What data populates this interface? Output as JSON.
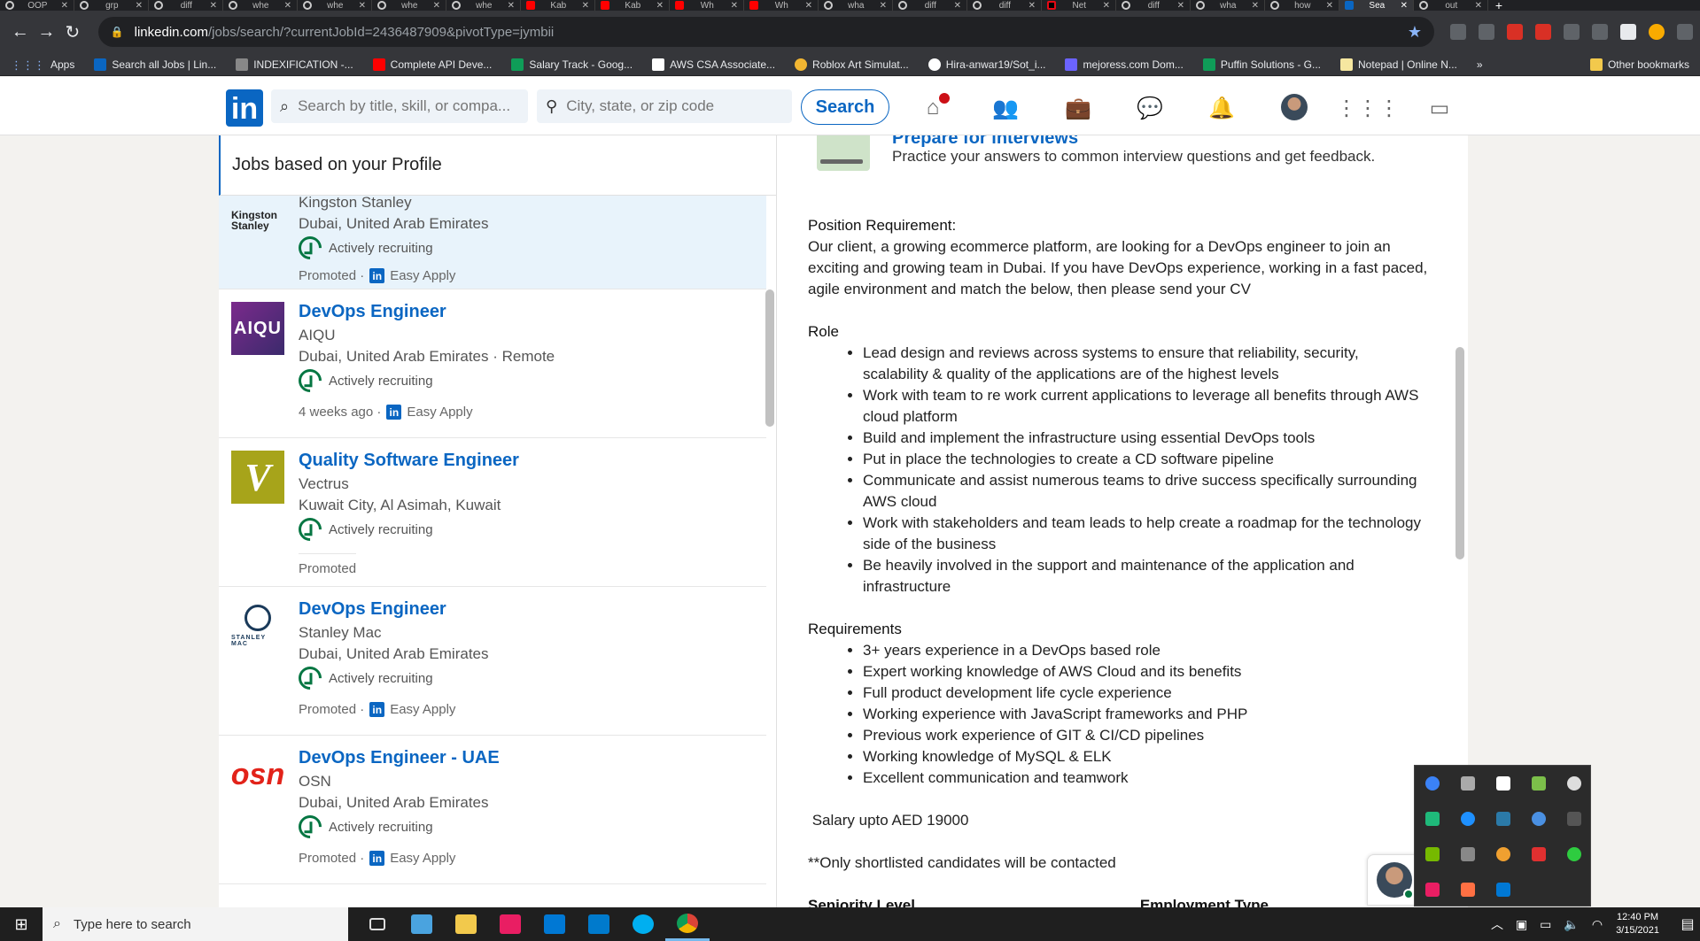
{
  "browser": {
    "tabs": [
      {
        "label": "OOP",
        "icon": "chrome-icon"
      },
      {
        "label": "grp",
        "icon": "chrome-icon"
      },
      {
        "label": "diff",
        "icon": "chrome-icon"
      },
      {
        "label": "whe",
        "icon": "chrome-icon"
      },
      {
        "label": "whe",
        "icon": "chrome-icon"
      },
      {
        "label": "whe",
        "icon": "chrome-icon"
      },
      {
        "label": "whe",
        "icon": "chrome-icon"
      },
      {
        "label": "Kab",
        "icon": "youtube-icon"
      },
      {
        "label": "Kab",
        "icon": "youtube-icon"
      },
      {
        "label": "Wh",
        "icon": "youtube-icon"
      },
      {
        "label": "Wh",
        "icon": "youtube-icon"
      },
      {
        "label": "wha",
        "icon": "chrome-icon"
      },
      {
        "label": "diff",
        "icon": "chrome-icon"
      },
      {
        "label": "diff",
        "icon": "chrome-icon"
      },
      {
        "label": "Net",
        "icon": "netflix-icon"
      },
      {
        "label": "diff",
        "icon": "chrome-icon"
      },
      {
        "label": "wha",
        "icon": "chrome-icon"
      },
      {
        "label": "how",
        "icon": "chrome-icon"
      },
      {
        "label": "Sea",
        "icon": "linkedin-icon",
        "active": true
      },
      {
        "label": "out",
        "icon": "chrome-icon"
      }
    ],
    "url_host": "linkedin.com",
    "url_path": "/jobs/search/?currentJobId=2436487909&pivotType=jymbii",
    "bookmarks": [
      {
        "label": "Apps",
        "icon": "apps-grid-icon"
      },
      {
        "label": "Search all Jobs | Lin...",
        "icon": "linkedin-icon"
      },
      {
        "label": "INDEXIFICATION -...",
        "icon": "blank-icon"
      },
      {
        "label": "Complete API Deve...",
        "icon": "youtube-icon"
      },
      {
        "label": "Salary Track - Goog...",
        "icon": "sheets-icon"
      },
      {
        "label": "AWS CSA Associate...",
        "icon": "aws-icon"
      },
      {
        "label": "Roblox Art Simulat...",
        "icon": "roblox-icon"
      },
      {
        "label": "Hira-anwar19/Sot_i...",
        "icon": "github-icon"
      },
      {
        "label": "mejoress.com Dom...",
        "icon": "mail-icon"
      },
      {
        "label": "Puffin Solutions - G...",
        "icon": "sheets-icon"
      },
      {
        "label": "Notepad | Online N...",
        "icon": "notepad-icon"
      }
    ],
    "bookmarks_more": "»",
    "other_bookmarks": "Other bookmarks"
  },
  "linkedin": {
    "logo": "in",
    "search_placeholder": "Search by title, skill, or compa...",
    "location_placeholder": "City, state, or zip code",
    "search_button": "Search",
    "brand_color": "#0a66c2"
  },
  "list": {
    "header": "Jobs based on your Profile",
    "jobs": [
      {
        "logo_text": "Kingston Stanley",
        "company": "Kingston Stanley",
        "location": "Dubai, United Arab Emirates",
        "recruiting": "Actively recruiting",
        "footer_text": "Promoted ·",
        "easy_apply": "Easy Apply"
      },
      {
        "logo_text": "AIQU",
        "title": "DevOps Engineer",
        "company": "AIQU",
        "location": "Dubai, United Arab Emirates · Remote",
        "recruiting": "Actively recruiting",
        "footer_text": "4 weeks ago ·",
        "easy_apply": "Easy Apply"
      },
      {
        "logo_text": "V",
        "title": "Quality Software Engineer",
        "company": "Vectrus",
        "location": "Kuwait City, Al Asimah, Kuwait",
        "recruiting": "Actively recruiting",
        "footer_text": "Promoted"
      },
      {
        "logo_text": "STANLEY MAC",
        "title": "DevOps Engineer",
        "company": "Stanley Mac",
        "location": "Dubai, United Arab Emirates",
        "recruiting": "Actively recruiting",
        "footer_text": "Promoted ·",
        "easy_apply": "Easy Apply"
      },
      {
        "logo_text": "osn",
        "title": "DevOps Engineer - UAE",
        "company": "OSN",
        "location": "Dubai, United Arab Emirates",
        "recruiting": "Actively recruiting",
        "footer_text": "Promoted ·",
        "easy_apply": "Easy Apply"
      }
    ]
  },
  "detail": {
    "prep_title": "Prepare for interviews",
    "prep_desc": "Practice your answers to common interview questions and get feedback.",
    "position_heading": "Position Requirement:",
    "position_text": "Our client, a growing ecommerce platform, are looking for a DevOps engineer to join an exciting and growing team in Dubai. If you have DevOps experience, working in a fast paced, agile environment and match the below, then please send your CV",
    "role_heading": "Role",
    "role_items": [
      "Lead design and reviews across systems to ensure that reliability, security, scalability & quality of the applications are of the highest levels",
      "Work with team to re work current applications to leverage all benefits through AWS cloud platform",
      "Build and implement the infrastructure using essential DevOps tools",
      "Put in place the technologies to create a CD software pipeline",
      "Communicate and assist numerous teams to drive success specifically surrounding AWS cloud",
      "Work with stakeholders and team leads to help create a roadmap for the technology side of the business",
      "Be heavily involved in the support and maintenance of the application and infrastructure"
    ],
    "requirements_heading": "Requirements",
    "requirements_items": [
      "3+ years experience in a DevOps based role",
      "Expert working knowledge of AWS Cloud and its benefits",
      "Full product development life cycle experience",
      "Working experience with JavaScript frameworks and PHP",
      "Previous work experience of GIT & CI/CD pipelines",
      "Working knowledge of MySQL & ELK",
      "Excellent communication and teamwork"
    ],
    "salary": " Salary upto AED 19000",
    "shortlist_note": "**Only shortlisted candidates will be contacted",
    "seniority_label": "Seniority Level",
    "employment_label": "Employment Type"
  },
  "messaging": {
    "more": "···",
    "collapse": "︿"
  },
  "taskbar": {
    "search_placeholder": "Type here to search",
    "time": "12:40 PM",
    "date": "3/15/2021"
  }
}
